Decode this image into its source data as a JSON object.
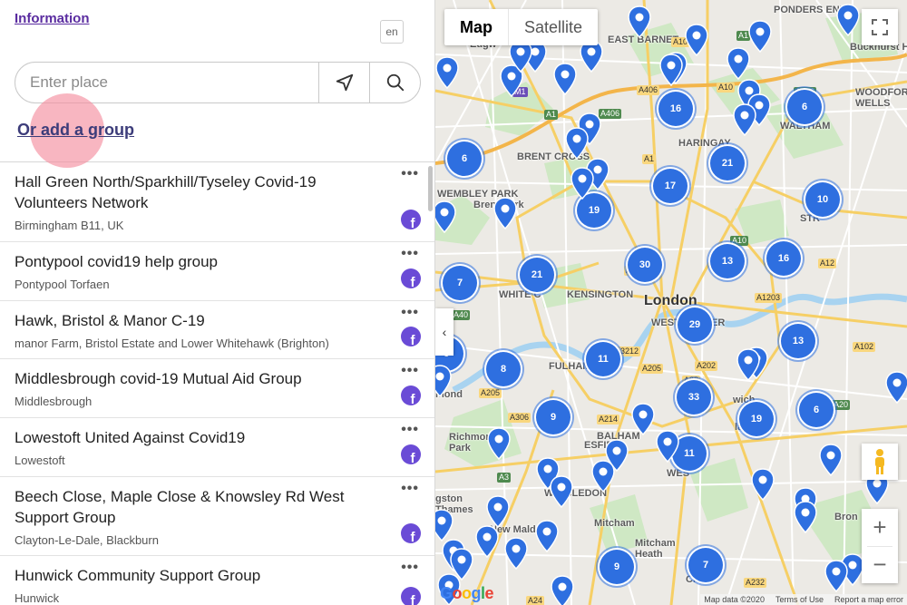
{
  "panel": {
    "info_link": "Information",
    "language": "en",
    "search_placeholder": "Enter place",
    "add_group_link": "Or add a group"
  },
  "groups": [
    {
      "title": "Hall Green North/Sparkhill/Tyseley Covid-19 Volunteers Network",
      "location": "Birmingham B11, UK"
    },
    {
      "title": "Pontypool covid19 help group",
      "location": "Pontypool Torfaen"
    },
    {
      "title": "Hawk, Bristol & Manor C-19",
      "location": "manor Farm, Bristol Estate and Lower Whitehawk (Brighton)"
    },
    {
      "title": "Middlesbrough covid-19 Mutual Aid Group",
      "location": "Middlesbrough"
    },
    {
      "title": "Lowestoft United Against Covid19",
      "location": "Lowestoft"
    },
    {
      "title": "Beech Close, Maple Close & Knowsley Rd West Support Group",
      "location": "Clayton-Le-Dale, Blackburn"
    },
    {
      "title": "Hunwick Community Support Group",
      "location": "Hunwick"
    }
  ],
  "group_menu_label": "•••",
  "social_icon_letter": "f",
  "map": {
    "type_map": "Map",
    "type_satellite": "Satellite",
    "collapse_label": "‹",
    "zoom_in": "+",
    "zoom_out": "−",
    "google": "Google",
    "attribution": [
      "Map data ©2020",
      "Terms of Use",
      "Report a map error"
    ],
    "places": [
      {
        "name": "London",
        "big": true
      },
      {
        "name": "EAST BARNET"
      },
      {
        "name": "PONDERS END"
      },
      {
        "name": "Edgw"
      },
      {
        "name": "Bucknurst H"
      },
      {
        "name": "WOODFORD WELLS"
      },
      {
        "name": "HARINGAY"
      },
      {
        "name": "WALTHAM"
      },
      {
        "name": "BRENT CROSS"
      },
      {
        "name": "WEMBLEY PARK"
      },
      {
        "name": "Brent Park"
      },
      {
        "name": "STR"
      },
      {
        "name": "WHITE C"
      },
      {
        "name": "KENSINGTON"
      },
      {
        "name": "WESTMINSTER"
      },
      {
        "name": "FULHAM"
      },
      {
        "name": "Richmond Park"
      },
      {
        "name": "mond"
      },
      {
        "name": "BALHAM"
      },
      {
        "name": "WIMBLEDON"
      },
      {
        "name": "New Malden"
      },
      {
        "name": "gston Thames"
      },
      {
        "name": "Mitcham"
      },
      {
        "name": "Mitcham Heath"
      },
      {
        "name": "Bron"
      },
      {
        "name": "Cro"
      },
      {
        "name": "wich"
      },
      {
        "name": "lage"
      },
      {
        "name": "WES"
      },
      {
        "name": "ESFIE"
      }
    ],
    "roads": [
      "A1",
      "A10",
      "A406",
      "A1",
      "A41",
      "A503",
      "A10",
      "A501",
      "A406",
      "A40",
      "A12",
      "A1203",
      "A3212",
      "A202",
      "A23",
      "A205",
      "A306",
      "A214",
      "A3",
      "A205",
      "A102",
      "A20",
      "A232",
      "A24",
      "A406",
      "M1",
      "A1",
      "A406",
      "A10"
    ],
    "clusters": [
      "16",
      "6",
      "6",
      "21",
      "17",
      "19",
      "10",
      "13",
      "16",
      "30",
      "21",
      "7",
      "29",
      "13",
      "11",
      "6",
      "8",
      "33",
      "9",
      "19",
      "6",
      "11",
      "9",
      "7"
    ]
  }
}
